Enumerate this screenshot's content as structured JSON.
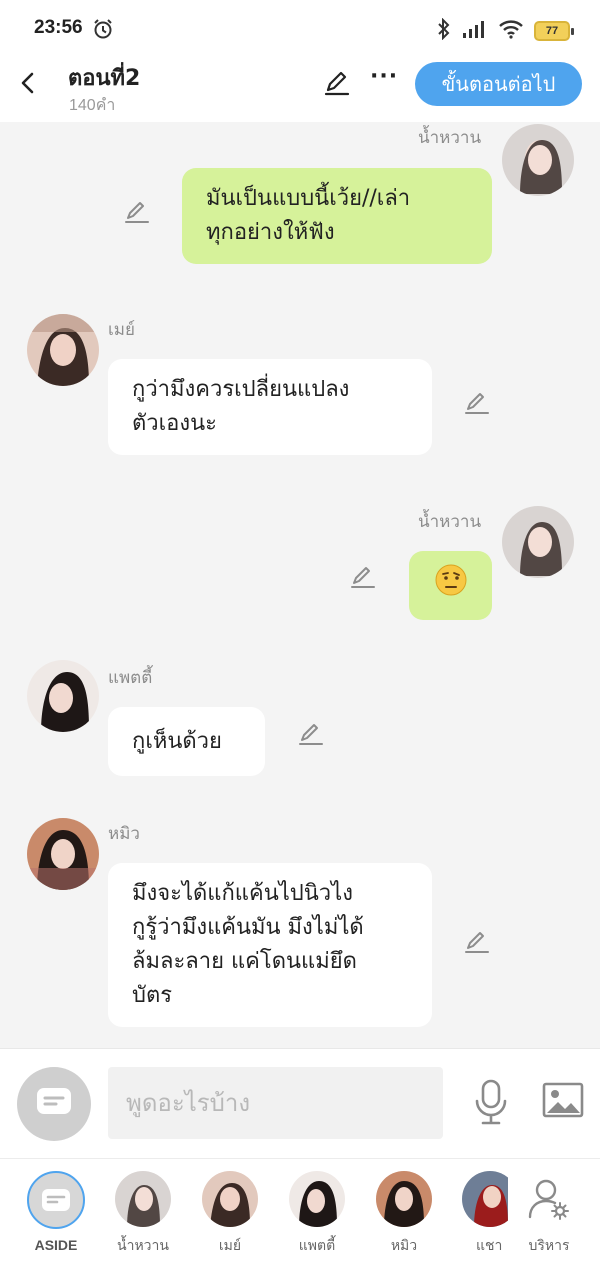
{
  "status_bar": {
    "time": "23:56",
    "battery": "77",
    "icons": [
      "alarm-icon",
      "bluetooth-icon",
      "signal-icon",
      "wifi-icon",
      "battery-icon"
    ]
  },
  "header": {
    "title": "ตอนที่2",
    "word_count": "140คำ",
    "more_label": "···",
    "next_button": "ขั้นตอนต่อไป"
  },
  "messages": [
    {
      "sender": "น้ำหวาน",
      "side": "right",
      "lines": [
        "มันเป็นแบบนี้เว้ย//เล่า",
        "ทุกอย่างให้ฟัง"
      ]
    },
    {
      "sender": "เมย์",
      "side": "left",
      "lines": [
        "กูว่ามึงควรเปลี่ยนแปลง",
        "ตัวเองนะ"
      ]
    },
    {
      "sender": "น้ำหวาน",
      "side": "right",
      "lines": [
        "🤨"
      ]
    },
    {
      "sender": "แพตตี้",
      "side": "left",
      "lines": [
        "กูเห็นด้วย"
      ]
    },
    {
      "sender": "หมิว",
      "side": "left",
      "lines": [
        "มึงจะได้แก้แค้นไปนิวไง",
        "กูรู้ว่ามึงแค้นมัน มึงไม่ได้",
        "ล้มละลาย แค่โดนแม่ยึด",
        "บัตร"
      ]
    }
  ],
  "input": {
    "placeholder": "พูดอะไรบ้าง",
    "icons": [
      "aside-icon",
      "mic-icon",
      "image-icon"
    ]
  },
  "characters": [
    {
      "label": "ASIDE"
    },
    {
      "label": "น้ำหวาน"
    },
    {
      "label": "เมย์"
    },
    {
      "label": "แพตตี้"
    },
    {
      "label": "หมิว"
    },
    {
      "label": "แชา"
    },
    {
      "label": "บริหาร"
    }
  ],
  "colors": {
    "accent": "#4fa4ee",
    "my_bubble": "#d6f29a",
    "their_bubble": "#ffffff",
    "background": "#f4f4f4"
  }
}
